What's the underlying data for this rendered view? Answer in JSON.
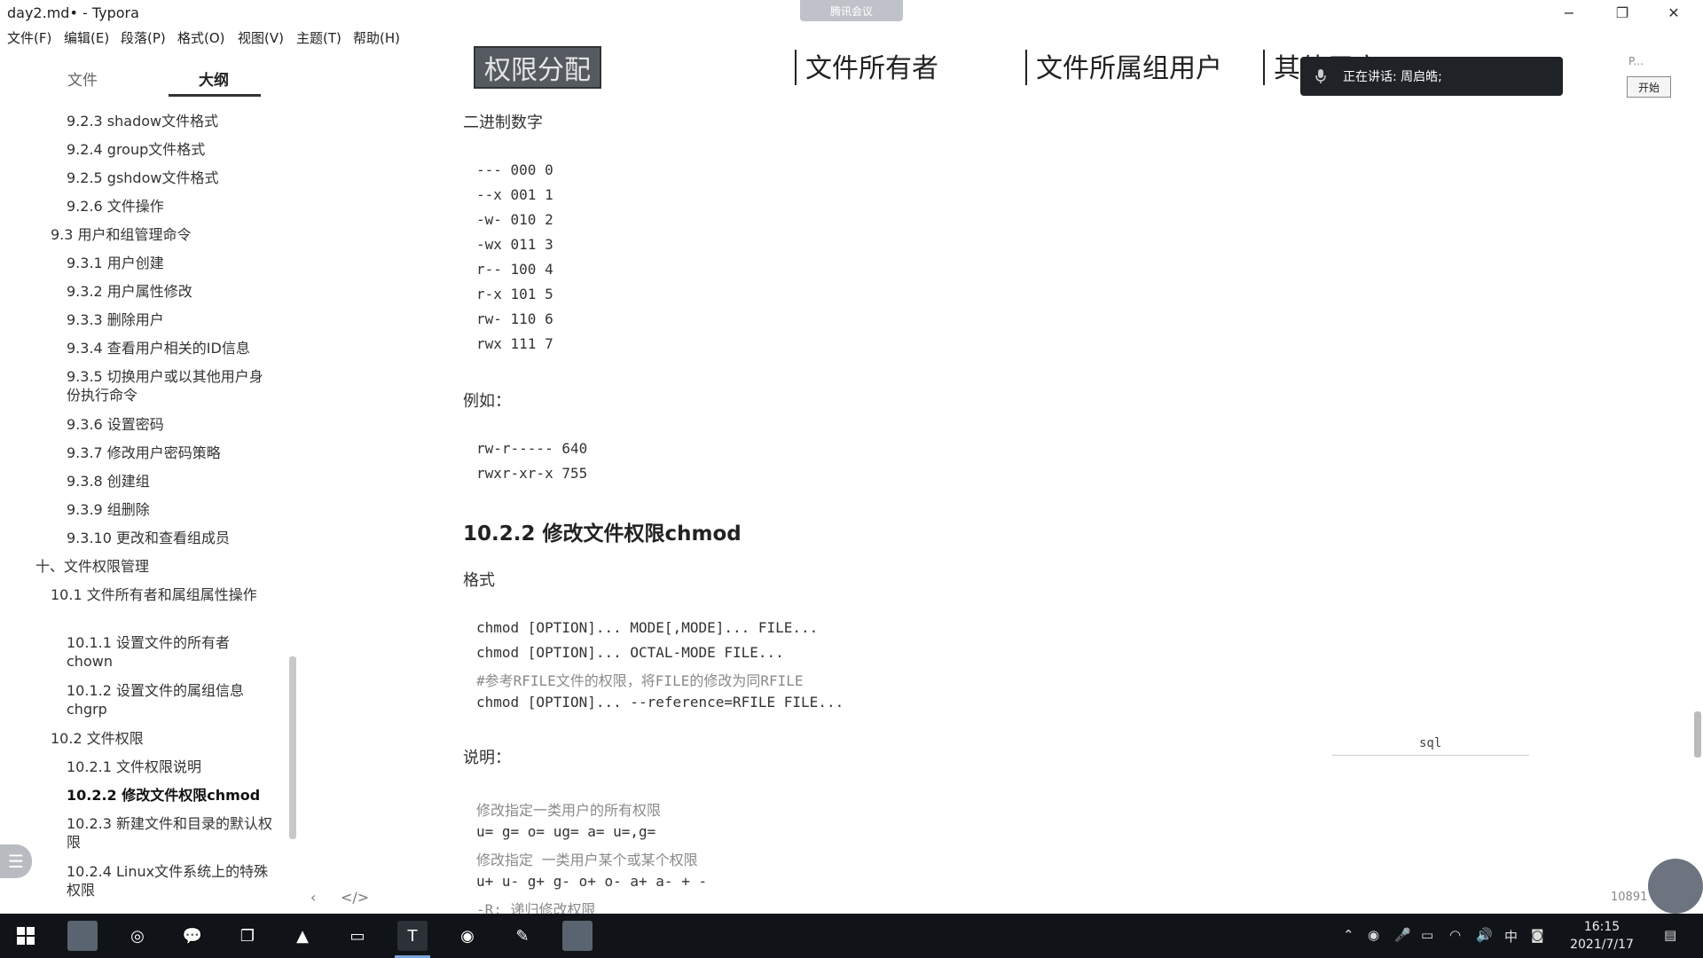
{
  "window": {
    "title": "day2.md• - Typora",
    "meeting_banner": "腾讯会议",
    "controls": {
      "minimize": "−",
      "restore": "❐",
      "close": "✕"
    }
  },
  "menu": [
    "文件(F)",
    "编辑(E)",
    "段落(P)",
    "格式(O)",
    "视图(V)",
    "主题(T)",
    "帮助(H)"
  ],
  "sidebar": {
    "tabs": {
      "files": "文件",
      "outline": "大纲"
    },
    "outline": [
      "9.2.3 shadow文件格式",
      "9.2.4 group文件格式",
      "9.2.5 gshdow文件格式",
      "9.2.6 文件操作",
      "9.3 用户和组管理命令",
      "9.3.1 用户创建",
      "9.3.2 用户属性修改",
      "9.3.3 删除用户",
      "9.3.4 查看用户相关的ID信息",
      "9.3.5 切换用户或以其他用户身份执行命令",
      "9.3.6 设置密码",
      "9.3.7 修改用户密码策略",
      "9.3.8 创建组",
      "9.3.9 组删除",
      "9.3.10 更改和查看组成员",
      "十、文件权限管理",
      "10.1 文件所有者和属组属性操作",
      "10.1.1 设置文件的所有者chown",
      "10.1.2 设置文件的属组信息chgrp",
      "10.2 文件权限",
      "10.2.1 文件权限说明",
      "10.2.2 修改文件权限chmod",
      "10.2.3 新建文件和目录的默认权限",
      "10.2.4 Linux文件系统上的特殊权限"
    ],
    "bottom": {
      "back": "‹",
      "source": "</>"
    }
  },
  "editor": {
    "table_header": [
      "权限分配",
      "文件所有者",
      "文件所属组用户",
      "其他用户"
    ],
    "binary_label": "二进制数字",
    "binary_table": [
      "--- 000 0",
      "--x 001 1",
      "-w- 010 2",
      "-wx 011 3",
      "r-- 100 4",
      "r-x 101 5",
      "rw- 110 6",
      "rwx 111 7"
    ],
    "example_label": "例如：",
    "examples": [
      "rw-r----- 640",
      "rwxr-xr-x 755"
    ],
    "heading": "10.2.2 修改文件权限chmod",
    "format_label": "格式",
    "format_code": [
      "chmod [OPTION]... MODE[,MODE]... FILE...",
      "chmod [OPTION]... OCTAL-MODE FILE..."
    ],
    "format_comment": "#参考RFILE文件的权限，将FILE的修改为同RFILE",
    "format_code_ref": "chmod [OPTION]... --reference=RFILE FILE...",
    "desc_label": "说明：",
    "desc": [
      "修改指定一类用户的所有权限",
      "u= g= o= ug= a= u=,g=",
      "修改指定 一类用户某个或某个权限",
      "u+ u- g+ g- o+ o- a+ a- + -",
      "-R: 递归修改权限"
    ],
    "code_lang": "sql",
    "word_count": "10891"
  },
  "meeting": {
    "speaking": "正在讲话: 周启皓;",
    "start": "开始",
    "p": "P..."
  },
  "taskbar": {
    "tray_ime": "中",
    "time": "16:15",
    "date": "2021/7/17"
  }
}
